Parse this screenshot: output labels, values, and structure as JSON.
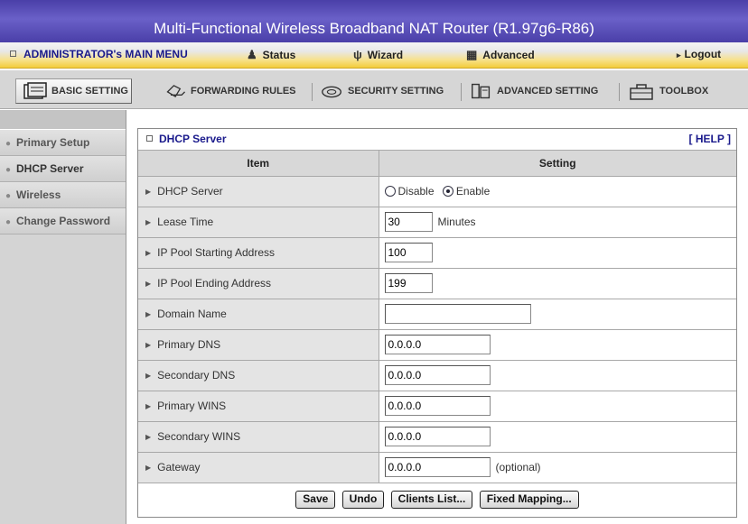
{
  "window": {
    "title": "Multi-Functional Wireless Broadband NAT Router (R1.97g6-R86)"
  },
  "menu": {
    "main_menu": "ADMINISTRATOR's MAIN MENU",
    "status": "Status",
    "wizard": "Wizard",
    "advanced": "Advanced",
    "logout": "Logout"
  },
  "tabs": [
    {
      "label": "BASIC SETTING",
      "icon": "basic-setting-icon",
      "active": true
    },
    {
      "label": "FORWARDING RULES",
      "icon": "forwarding-rules-icon",
      "active": false
    },
    {
      "label": "SECURITY SETTING",
      "icon": "security-setting-icon",
      "active": false
    },
    {
      "label": "ADVANCED SETTING",
      "icon": "advanced-setting-icon",
      "active": false
    },
    {
      "label": "TOOLBOX",
      "icon": "toolbox-icon",
      "active": false
    }
  ],
  "sidebar": {
    "items": [
      {
        "label": "Primary Setup"
      },
      {
        "label": "DHCP Server"
      },
      {
        "label": "Wireless"
      },
      {
        "label": "Change Password"
      }
    ]
  },
  "panel": {
    "title": "DHCP Server",
    "help": "[ HELP ]",
    "col_item": "Item",
    "col_setting": "Setting"
  },
  "form": {
    "dhcp_server": {
      "label": "DHCP Server",
      "disable": "Disable",
      "enable": "Enable",
      "selected": "Enable"
    },
    "lease_time": {
      "label": "Lease Time",
      "value": "30",
      "unit": "Minutes"
    },
    "pool_start": {
      "label": "IP Pool Starting Address",
      "value": "100"
    },
    "pool_end": {
      "label": "IP Pool Ending Address",
      "value": "199"
    },
    "domain_name": {
      "label": "Domain Name",
      "value": ""
    },
    "primary_dns": {
      "label": "Primary DNS",
      "value": "0.0.0.0"
    },
    "secondary_dns": {
      "label": "Secondary DNS",
      "value": "0.0.0.0"
    },
    "primary_wins": {
      "label": "Primary WINS",
      "value": "0.0.0.0"
    },
    "secondary_wins": {
      "label": "Secondary WINS",
      "value": "0.0.0.0"
    },
    "gateway": {
      "label": "Gateway",
      "value": "0.0.0.0",
      "note": "(optional)"
    }
  },
  "buttons": {
    "save": "Save",
    "undo": "Undo",
    "clients_list": "Clients List...",
    "fixed_mapping": "Fixed Mapping..."
  },
  "colors": {
    "title_bar": "#4a3fa8",
    "menu_accent": "#f3cc3a",
    "link_blue": "#1a1a8c"
  }
}
